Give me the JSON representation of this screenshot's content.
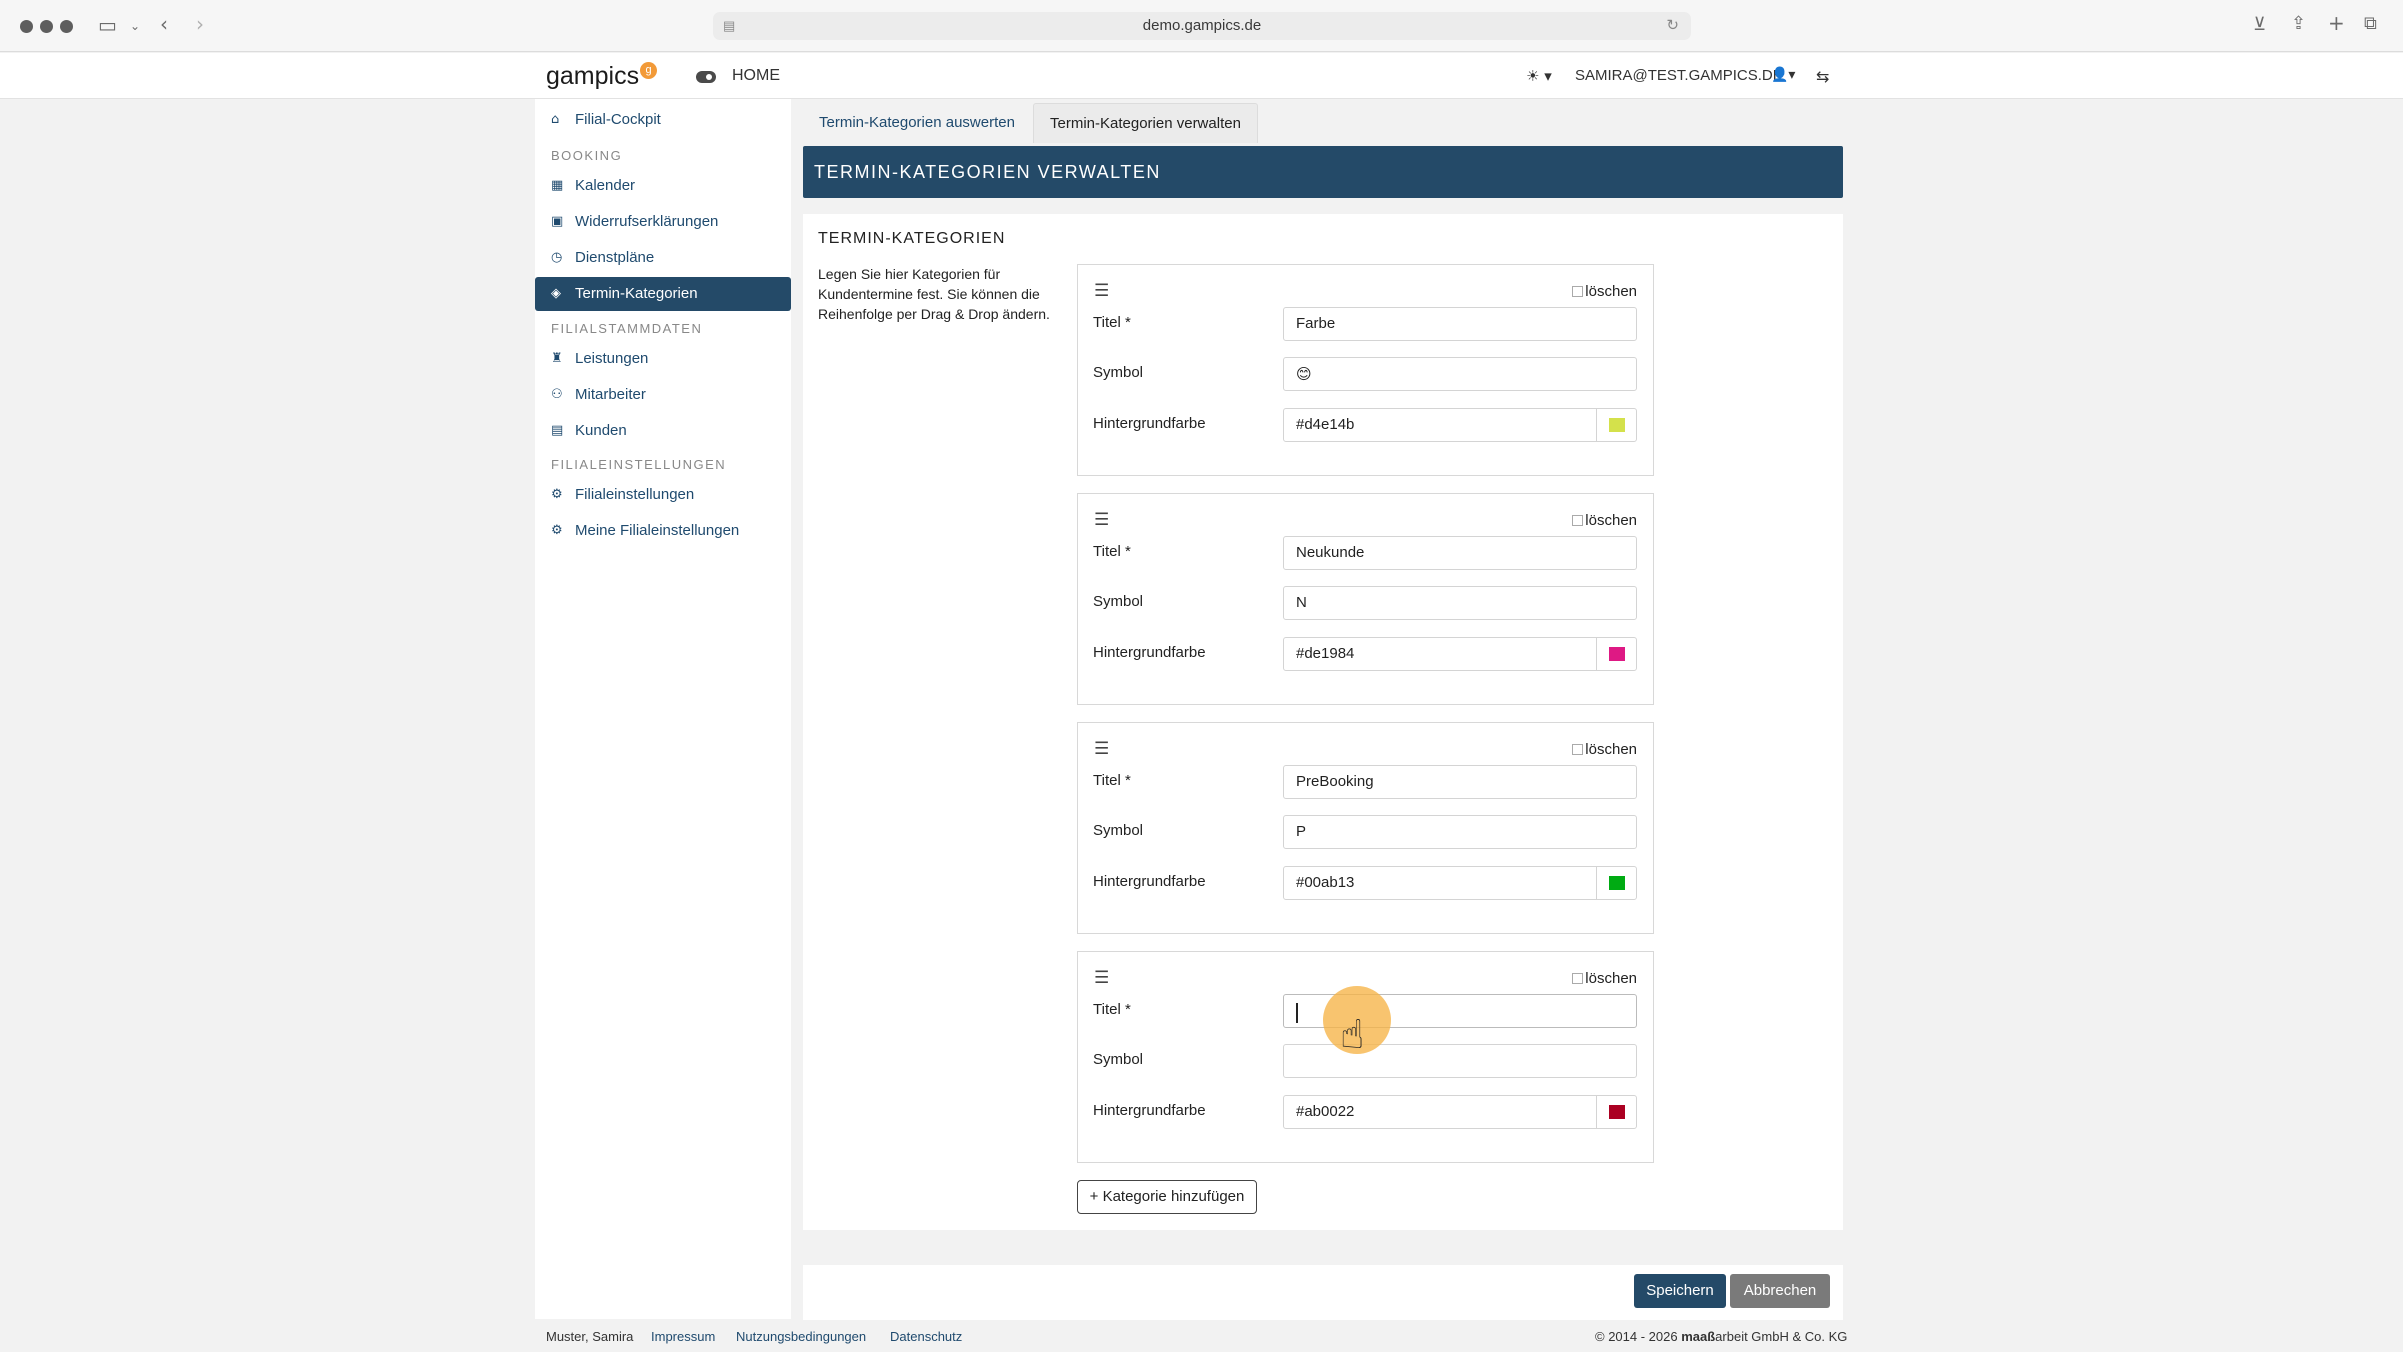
{
  "browser": {
    "url": "demo.gampics.de",
    "lock_icon": "page-icon",
    "reload_icon": "reload-icon"
  },
  "navbar": {
    "logo": "gampics",
    "logo_badge": "g",
    "home": "HOME",
    "user": "SAMIRA@TEST.GAMPICS.DE"
  },
  "sidebar": {
    "cockpit": "Filial-Cockpit",
    "booking_head": "BOOKING",
    "kalender": "Kalender",
    "widerruf": "Widerrufserklärungen",
    "dienstplaene": "Dienstpläne",
    "termin": "Termin-Kategorien",
    "stamm_head": "FILIALSTAMMDATEN",
    "leistungen": "Leistungen",
    "mitarbeiter": "Mitarbeiter",
    "kunden": "Kunden",
    "einst_head": "FILIALEINSTELLUNGEN",
    "filialeinst": "Filialeinstellungen",
    "meine": "Meine Filialeinstellungen"
  },
  "tabs": {
    "auswerten": "Termin-Kategorien auswerten",
    "verwalten": "Termin-Kategorien verwalten"
  },
  "page_title": "TERMIN-KATEGORIEN VERWALTEN",
  "section": {
    "title": "TERMIN-KATEGORIEN",
    "description": "Legen Sie hier Kategorien für Kundentermine fest. Sie können die Reihenfolge per Drag & Drop ändern."
  },
  "labels": {
    "delete": "löschen",
    "title": "Titel *",
    "symbol": "Symbol",
    "bg": "Hintergrundfarbe"
  },
  "categories": [
    {
      "title": "Farbe",
      "symbol": "😊",
      "color": "#d4e14b"
    },
    {
      "title": "Neukunde",
      "symbol": "N",
      "color": "#de1984"
    },
    {
      "title": "PreBooking",
      "symbol": "P",
      "color": "#00ab13"
    },
    {
      "title": "",
      "symbol": "",
      "color": "#ab0022"
    }
  ],
  "add_button": "+ Kategorie hinzufügen",
  "actions": {
    "save": "Speichern",
    "cancel": "Abbrechen"
  },
  "footer": {
    "user": "Muster, Samira",
    "impressum": "Impressum",
    "nutzung": "Nutzungsbedingungen",
    "datenschutz": "Datenschutz",
    "copyright_pre": "© 2014 - 2026 ",
    "copyright_brand": "maaß",
    "copyright_post": "arbeit GmbH & Co. KG"
  }
}
